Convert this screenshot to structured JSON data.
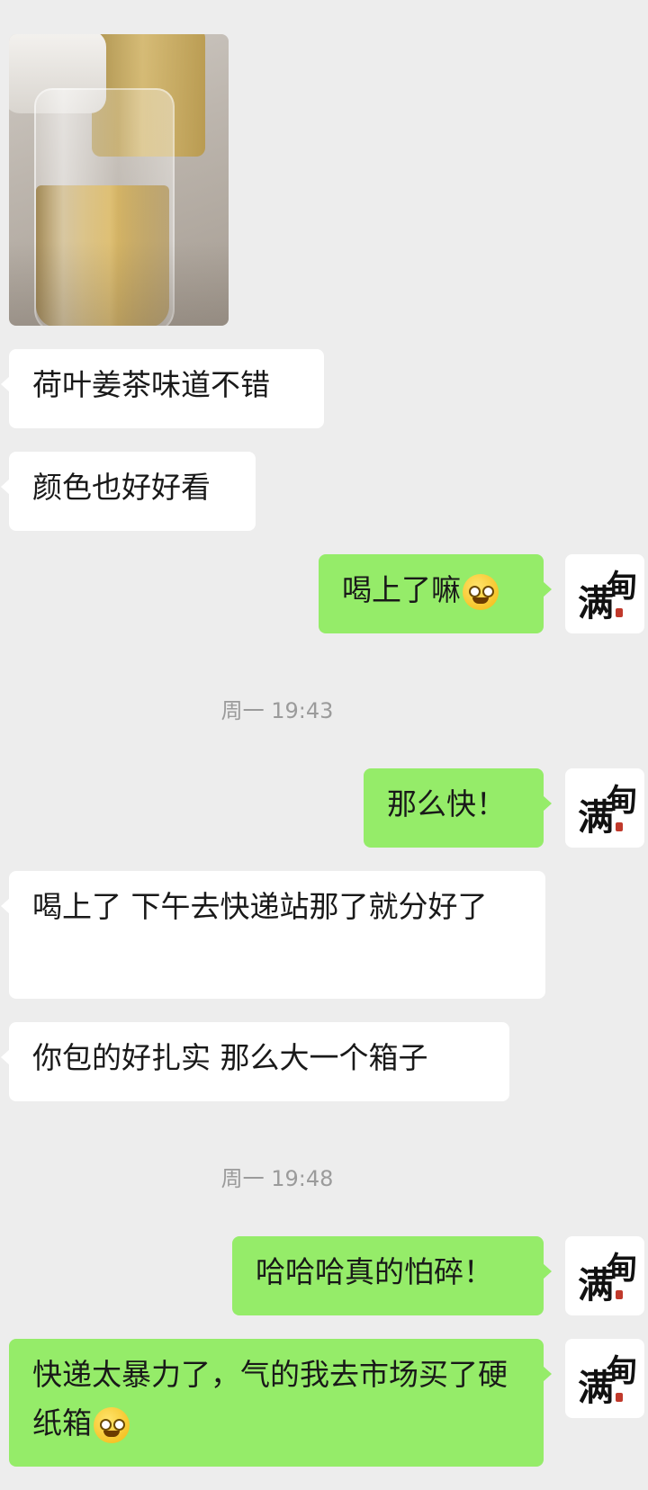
{
  "messages": [
    {
      "id": "m1",
      "text": "荷叶姜茶味道不错"
    },
    {
      "id": "m2",
      "text": "颜色也好好看"
    },
    {
      "id": "m3",
      "text": "喝上了嘛"
    },
    {
      "id": "m4",
      "text": "那么快！"
    },
    {
      "id": "m5",
      "text": "喝上了  下午去快递站那了就分好了"
    },
    {
      "id": "m6",
      "text": "你包的好扎实  那么大一个箱子"
    },
    {
      "id": "m7",
      "text": "哈哈哈真的怕碎！"
    },
    {
      "id": "m8",
      "text": "快递太暴力了，气的我去市场买了硬纸箱"
    }
  ],
  "timestamps": [
    "周一 19:43",
    "周一 19:48"
  ],
  "avatar": {
    "text_big": "满",
    "text_small": "甸"
  },
  "icons": {
    "emoji_1": "grin-emoji",
    "emoji_2": "grin-emoji"
  },
  "colors": {
    "background": "#ededed",
    "sent_bubble": "#95ec69",
    "received_bubble": "#ffffff"
  }
}
